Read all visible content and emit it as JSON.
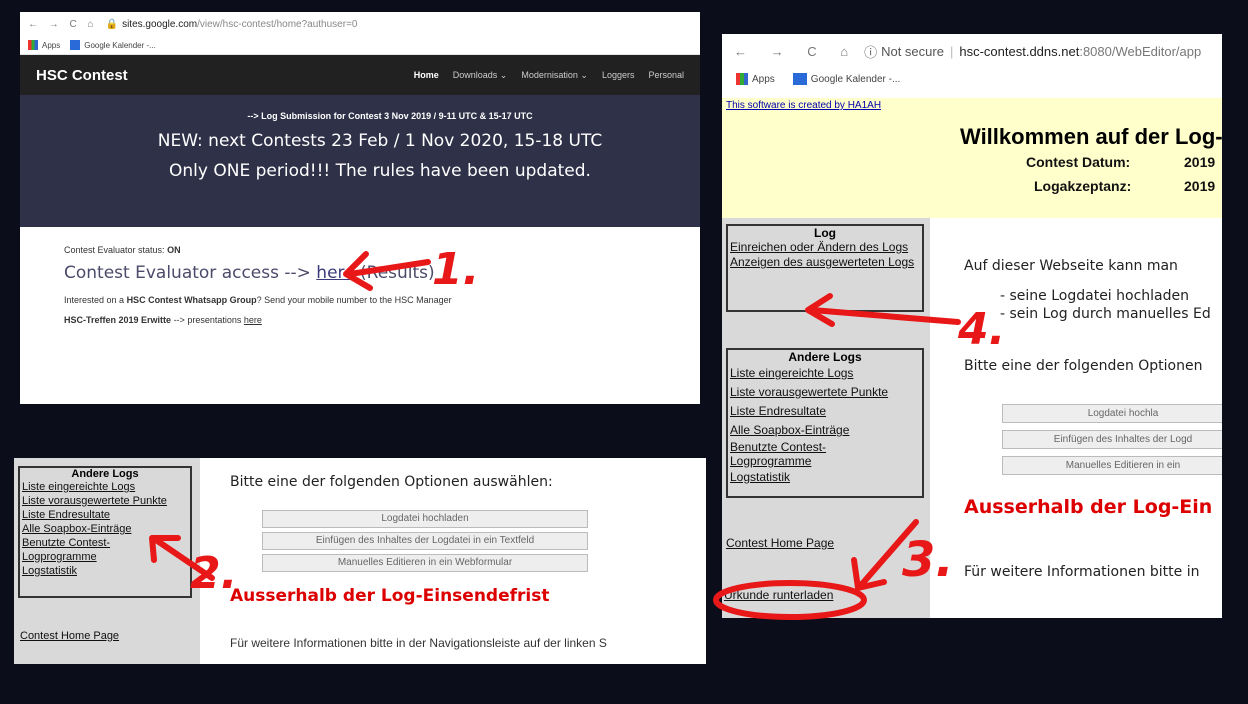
{
  "panel1": {
    "browser": {
      "url_host": "sites.google.com",
      "url_path": "/view/hsc-contest/home?authuser=0"
    },
    "bookmarks": [
      "Apps",
      "Google Kalender -..."
    ],
    "site_title": "HSC Contest",
    "nav": [
      "Home",
      "Downloads ⌄",
      "Modernisation ⌄",
      "Loggers",
      "Personal"
    ],
    "hero_small": "--> Log Submission for Contest 3 Nov 2019 / 9-11 UTC & 15-17 UTC",
    "hero_line1": "NEW: next Contests 23 Feb / 1 Nov 2020, 15-18 UTC",
    "hero_line2": "Only ONE period!!! The rules have been updated.",
    "status_label": "Contest Evaluator status:",
    "status_value": "ON",
    "evaluator_prefix": "Contest Evaluator access -->",
    "evaluator_link": "here",
    "evaluator_suffix": "(Results)",
    "whatsapp_pre": "Interested on a",
    "whatsapp_bold": "HSC Contest Whatsapp Group",
    "whatsapp_post": "? Send your mobile number to the HSC Manager",
    "treffen_bold": "HSC-Treffen 2019 Erwitte",
    "treffen_mid": "--> presentations",
    "treffen_link": "here"
  },
  "panel2": {
    "box_title": "Andere Logs",
    "links": [
      "Liste eingereichte Logs",
      "Liste vorausgewertete Punkte",
      "Liste Endresultate",
      "Alle Soapbox-Einträge",
      "Benutzte Contest-Logprogramme",
      "Logstatistik"
    ],
    "home": "Contest Home Page",
    "heading": "Bitte eine der folgenden Optionen auswählen:",
    "buttons": [
      "Logdatei hochladen",
      "Einfügen des Inhaltes der Logdatei in ein Textfeld",
      "Manuelles Editieren in ein Webformular"
    ],
    "red": "Ausserhalb der Log-Einsendefrist",
    "footer": "Für weitere Informationen bitte in der Navigationsleiste auf der linken S"
  },
  "panel3": {
    "browser": {
      "security": "Not secure",
      "url_host": "hsc-contest.ddns.net",
      "url_rest": ":8080/WebEditor/app"
    },
    "bookmarks": [
      "Apps",
      "Google Kalender -..."
    ],
    "created": "This software is created by HA1AH",
    "welcome": "Willkommen auf der Log-",
    "datum_label": "Contest Datum:",
    "datum_value": "2019",
    "akz_label": "Logakzeptanz:",
    "akz_value": "2019",
    "log_title": "Log",
    "log_links": [
      "Einreichen oder Ändern des Logs",
      "Anzeigen des ausgewerteten Logs"
    ],
    "other_title": "Andere Logs",
    "other_links": [
      "Liste eingereichte Logs",
      "Liste vorausgewertete Punkte",
      "Liste Endresultate",
      "Alle Soapbox-Einträge",
      "Benutzte Contest-Logprogramme",
      "Logstatistik"
    ],
    "home": "Contest Home Page",
    "urkunde": "Urkunde runterladen",
    "intro": "Auf dieser Webseite kann man",
    "bullet1": "- seine Logdatei hochladen",
    "bullet2": "- sein Log durch manuelles Ed",
    "choose": "Bitte eine der folgenden Optionen",
    "buttons": [
      "Logdatei hochla",
      "Einfügen des Inhaltes der Logd",
      "Manuelles Editieren in ein"
    ],
    "red": "Ausserhalb der Log-Ein",
    "footer": "Für weitere Informationen bitte in"
  },
  "annotations": [
    "1.",
    "2.",
    "3.",
    "4."
  ],
  "colors": {
    "background": "#0b0e1a",
    "annotation_red": "#e81818",
    "hero_bg": "#2f3148",
    "yellow": "#ffffcc"
  }
}
